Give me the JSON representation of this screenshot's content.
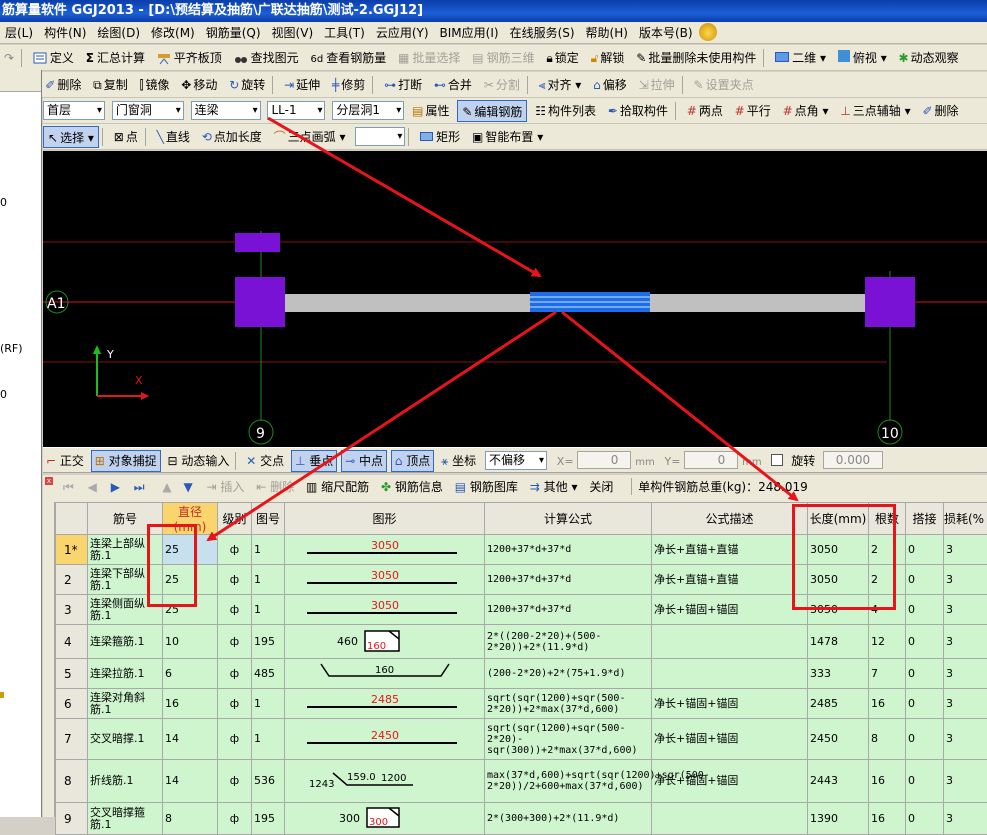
{
  "window": {
    "title": "筋算量软件 GGJ2013 - [D:\\预结算及抽筋\\广联达抽筋\\测试-2.GGJ12]"
  },
  "menu": [
    "层(L)",
    "构件(N)",
    "绘图(D)",
    "修改(M)",
    "钢筋量(Q)",
    "视图(V)",
    "工具(T)",
    "云应用(Y)",
    "BIM应用(I)",
    "在线服务(S)",
    "帮助(H)",
    "版本号(B)"
  ],
  "toolbar1": {
    "items": [
      "定义",
      "汇总计算",
      "平齐板顶",
      "查找图元",
      "查看钢筋量",
      "批量选择",
      "钢筋三维",
      "锁定",
      "解锁",
      "批量删除未使用构件",
      "二维",
      "俯视",
      "动态观察"
    ]
  },
  "toolbar2": {
    "items": [
      "删除",
      "复制",
      "镜像",
      "移动",
      "旋转",
      "延伸",
      "修剪",
      "打断",
      "合并",
      "分割",
      "对齐",
      "偏移",
      "拉伸",
      "设置夹点"
    ]
  },
  "toolbar3": {
    "floor": "首层",
    "category": "门窗洞",
    "type": "连梁",
    "name": "LL-1",
    "layer": "分层洞1",
    "items": [
      "属性",
      "编辑钢筋",
      "构件列表",
      "拾取构件",
      "两点",
      "平行",
      "点角",
      "三点辅轴",
      "删除"
    ]
  },
  "toolbar4": {
    "items": [
      "选择",
      "点",
      "直线",
      "点加长度",
      "三点画弧",
      "矩形",
      "智能布置"
    ]
  },
  "leftpanel": {
    "labels": [
      "0",
      "(RF)",
      "0"
    ]
  },
  "canvas": {
    "axis_a": "A1",
    "axis_9": "9",
    "axis_10": "10",
    "y_label": "Y",
    "x_label": "X"
  },
  "snapbar": {
    "items": [
      "正交",
      "对象捕捉",
      "动态输入",
      "交点",
      "垂点",
      "中点",
      "顶点",
      "坐标"
    ],
    "offset_mode": "不偏移",
    "x_label": "X=",
    "x_value": "0",
    "y_label": "Y=",
    "y_value": "0",
    "unit": "mm",
    "rotate_label": "旋转",
    "rotate_value": "0.000"
  },
  "tablebar": {
    "items": [
      "插入",
      "删除",
      "缩尺配筋",
      "钢筋信息",
      "钢筋图库",
      "其他",
      "关闭"
    ],
    "total_label": "单构件钢筋总重(kg)：248.019"
  },
  "table": {
    "headers": [
      "筋号",
      "直径(mm)",
      "级别",
      "图号",
      "图形",
      "计算公式",
      "公式描述",
      "长度(mm)",
      "根数",
      "搭接",
      "损耗(%"
    ],
    "rows": [
      {
        "no": "1*",
        "name": "连梁上部纵筋.1",
        "dia": "25",
        "grade": "ф",
        "fig": "1",
        "shape": "3050",
        "formula": "1200+37*d+37*d",
        "desc": "净长+直锚+直锚",
        "len": "3050",
        "count": "2",
        "lap": "0",
        "loss": "3"
      },
      {
        "no": "2",
        "name": "连梁下部纵筋.1",
        "dia": "25",
        "grade": "ф",
        "fig": "1",
        "shape": "3050",
        "formula": "1200+37*d+37*d",
        "desc": "净长+直锚+直锚",
        "len": "3050",
        "count": "2",
        "lap": "0",
        "loss": "3"
      },
      {
        "no": "3",
        "name": "连梁侧面纵筋.1",
        "dia": "25",
        "grade": "ф",
        "fig": "1",
        "shape": "3050",
        "formula": "1200+37*d+37*d",
        "desc": "净长+锚固+锚固",
        "len": "3050",
        "count": "4",
        "lap": "0",
        "loss": "3"
      },
      {
        "no": "4",
        "name": "连梁箍筋.1",
        "dia": "10",
        "grade": "ф",
        "fig": "195",
        "shape_a": "460",
        "shape_b": "160",
        "formula": "2*((200-2*20)+(500-2*20))+2*(11.9*d)",
        "desc": "",
        "len": "1478",
        "count": "12",
        "lap": "0",
        "loss": "3"
      },
      {
        "no": "5",
        "name": "连梁拉筋.1",
        "dia": "6",
        "grade": "ф",
        "fig": "485",
        "shape": "160",
        "formula": "(200-2*20)+2*(75+1.9*d)",
        "desc": "",
        "len": "333",
        "count": "7",
        "lap": "0",
        "loss": "3"
      },
      {
        "no": "6",
        "name": "连梁对角斜筋.1",
        "dia": "16",
        "grade": "ф",
        "fig": "1",
        "shape": "2485",
        "formula": "sqrt(sqr(1200)+sqr(500-2*20))+2*max(37*d,600)",
        "desc": "净长+锚固+锚固",
        "len": "2485",
        "count": "16",
        "lap": "0",
        "loss": "3"
      },
      {
        "no": "7",
        "name": "交叉暗撑.1",
        "dia": "14",
        "grade": "ф",
        "fig": "1",
        "shape": "2450",
        "formula": "sqrt(sqr(1200)+sqr(500-2*20)-sqr(300))+2*max(37*d,600)",
        "desc": "净长+锚固+锚固",
        "len": "2450",
        "count": "8",
        "lap": "0",
        "loss": "3"
      },
      {
        "no": "8",
        "name": "折线筋.1",
        "dia": "14",
        "grade": "ф",
        "fig": "536",
        "shape_a": "1243",
        "shape_b": "159.0",
        "shape_c": "1200",
        "formula": "max(37*d,600)+sqrt(sqr(1200)+sqr(500-2*20))/2+600+max(37*d,600)",
        "desc": "净长+锚固+锚固",
        "len": "2443",
        "count": "16",
        "lap": "0",
        "loss": "3"
      },
      {
        "no": "9",
        "name": "交叉暗撑箍筋.1",
        "dia": "8",
        "grade": "ф",
        "fig": "195",
        "shape_a": "300",
        "shape_b": "300",
        "formula": "2*(300+300)+2*(11.9*d)",
        "desc": "",
        "len": "1390",
        "count": "16",
        "lap": "0",
        "loss": "3"
      }
    ]
  },
  "colors": {
    "accent_red": "#e8141c",
    "column_purple": "#7a12d6",
    "beam_grey": "#c0c0c0",
    "rebar_blue": "#1b6ee8",
    "grid_green": "#cff5cf"
  }
}
